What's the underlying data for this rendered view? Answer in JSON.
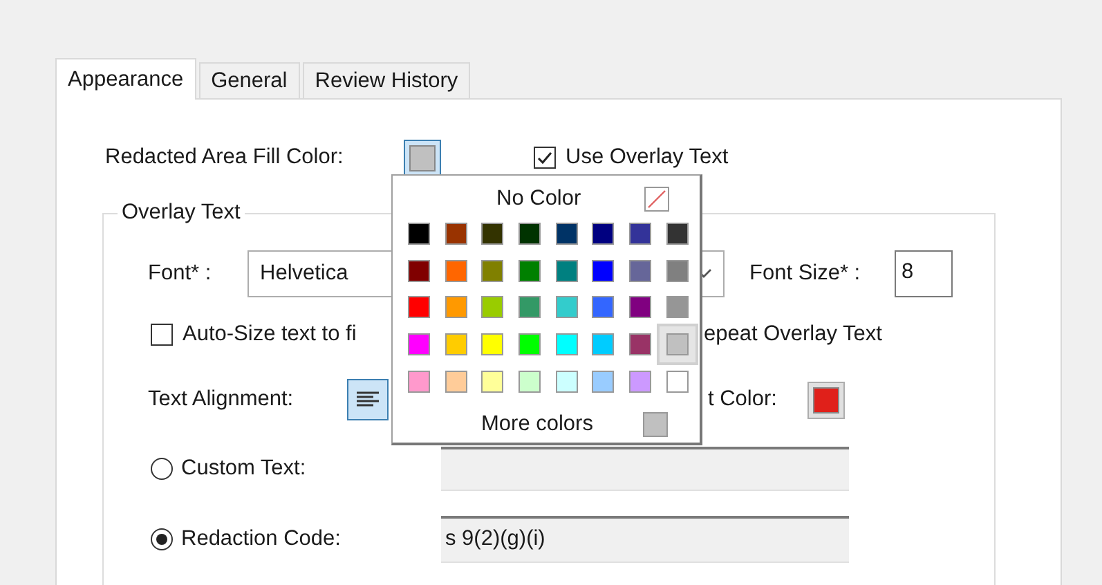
{
  "tabs": [
    {
      "label": "Appearance",
      "selected": true
    },
    {
      "label": "General",
      "selected": false
    },
    {
      "label": "Review History",
      "selected": false
    }
  ],
  "fill_color": {
    "label": "Redacted Area Fill Color:",
    "color": "#c0c0c0"
  },
  "use_overlay_text": {
    "label": "Use Overlay Text",
    "checked": true
  },
  "overlay_text": {
    "title": "Overlay Text",
    "font": {
      "label": "Font* :",
      "value": "Helvetica"
    },
    "font_size": {
      "label": "Font Size* :",
      "value": "8"
    },
    "auto_size": {
      "label": "Auto-Size text to fi",
      "checked": false
    },
    "repeat": {
      "label": "epeat Overlay Text"
    },
    "alignment": {
      "label": "Text Alignment:"
    },
    "text_color": {
      "label": "t Color:",
      "color": "#e0201a"
    },
    "options": [
      {
        "label": "Custom Text:",
        "selected": false
      },
      {
        "label": "Redaction Code:",
        "selected": true,
        "value": "s 9(2)(g)(i)"
      }
    ]
  },
  "color_popup": {
    "no_color": "No Color",
    "more_colors": "More colors",
    "swatches": [
      [
        {
          "color": "#000000",
          "selected": false
        },
        {
          "color": "#993300",
          "selected": false
        },
        {
          "color": "#333300",
          "selected": false
        },
        {
          "color": "#003300",
          "selected": false
        },
        {
          "color": "#003366",
          "selected": false
        },
        {
          "color": "#000080",
          "selected": false
        },
        {
          "color": "#333399",
          "selected": false
        },
        {
          "color": "#333333",
          "selected": false
        }
      ],
      [
        {
          "color": "#800000",
          "selected": false
        },
        {
          "color": "#ff6600",
          "selected": false
        },
        {
          "color": "#808000",
          "selected": false
        },
        {
          "color": "#008000",
          "selected": false
        },
        {
          "color": "#008080",
          "selected": false
        },
        {
          "color": "#0000ff",
          "selected": false
        },
        {
          "color": "#666699",
          "selected": false
        },
        {
          "color": "#808080",
          "selected": false
        }
      ],
      [
        {
          "color": "#ff0000",
          "selected": false
        },
        {
          "color": "#ff9900",
          "selected": false
        },
        {
          "color": "#99cc00",
          "selected": false
        },
        {
          "color": "#339966",
          "selected": false
        },
        {
          "color": "#33cccc",
          "selected": false
        },
        {
          "color": "#3366ff",
          "selected": false
        },
        {
          "color": "#800080",
          "selected": false
        },
        {
          "color": "#969696",
          "selected": false
        }
      ],
      [
        {
          "color": "#ff00ff",
          "selected": false
        },
        {
          "color": "#ffcc00",
          "selected": false
        },
        {
          "color": "#ffff00",
          "selected": false
        },
        {
          "color": "#00ff00",
          "selected": false
        },
        {
          "color": "#00ffff",
          "selected": false
        },
        {
          "color": "#00ccff",
          "selected": false
        },
        {
          "color": "#993366",
          "selected": false
        },
        {
          "color": "#c0c0c0",
          "selected": true
        }
      ],
      [
        {
          "color": "#ff99cc",
          "selected": false
        },
        {
          "color": "#ffcc99",
          "selected": false
        },
        {
          "color": "#ffff99",
          "selected": false
        },
        {
          "color": "#ccffcc",
          "selected": false
        },
        {
          "color": "#ccffff",
          "selected": false
        },
        {
          "color": "#99ccff",
          "selected": false
        },
        {
          "color": "#cc99ff",
          "selected": false
        },
        {
          "color": "#ffffff",
          "selected": false
        }
      ]
    ]
  }
}
